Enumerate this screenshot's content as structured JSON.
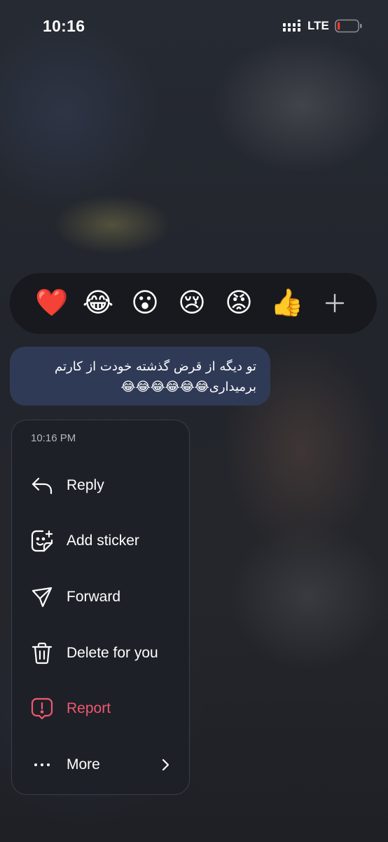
{
  "status_bar": {
    "time": "10:16",
    "network": "LTE",
    "battery_level": 0.12,
    "battery_color": "#ff3b30",
    "signal_icon": "signal-icon",
    "battery_icon": "battery-icon"
  },
  "reactions": [
    {
      "emoji": "❤️",
      "name": "red-heart"
    },
    {
      "emoji": "😂",
      "name": "tears-of-joy"
    },
    {
      "emoji": "😮",
      "name": "surprised"
    },
    {
      "emoji": "😢",
      "name": "crying"
    },
    {
      "emoji": "😡",
      "name": "angry"
    },
    {
      "emoji": "👍",
      "name": "thumbs-up"
    }
  ],
  "reaction_more_icon": "plus-icon",
  "message": {
    "text": "تو دیگه از قرض گذشته خودت از کارتم برمیداری😂😂😂😂😂😂",
    "bubble_color": "#2f3a56"
  },
  "context_menu": {
    "timestamp": "10:16 PM",
    "items": [
      {
        "label": "Reply",
        "icon": "reply-icon"
      },
      {
        "label": "Add sticker",
        "icon": "sticker-icon"
      },
      {
        "label": "Forward",
        "icon": "send-icon"
      },
      {
        "label": "Delete for you",
        "icon": "trash-icon"
      },
      {
        "label": "Report",
        "icon": "report-icon",
        "color": "#f0586f"
      },
      {
        "label": "More",
        "icon": "more-icon",
        "chevron": "chevron-right-icon"
      }
    ]
  }
}
